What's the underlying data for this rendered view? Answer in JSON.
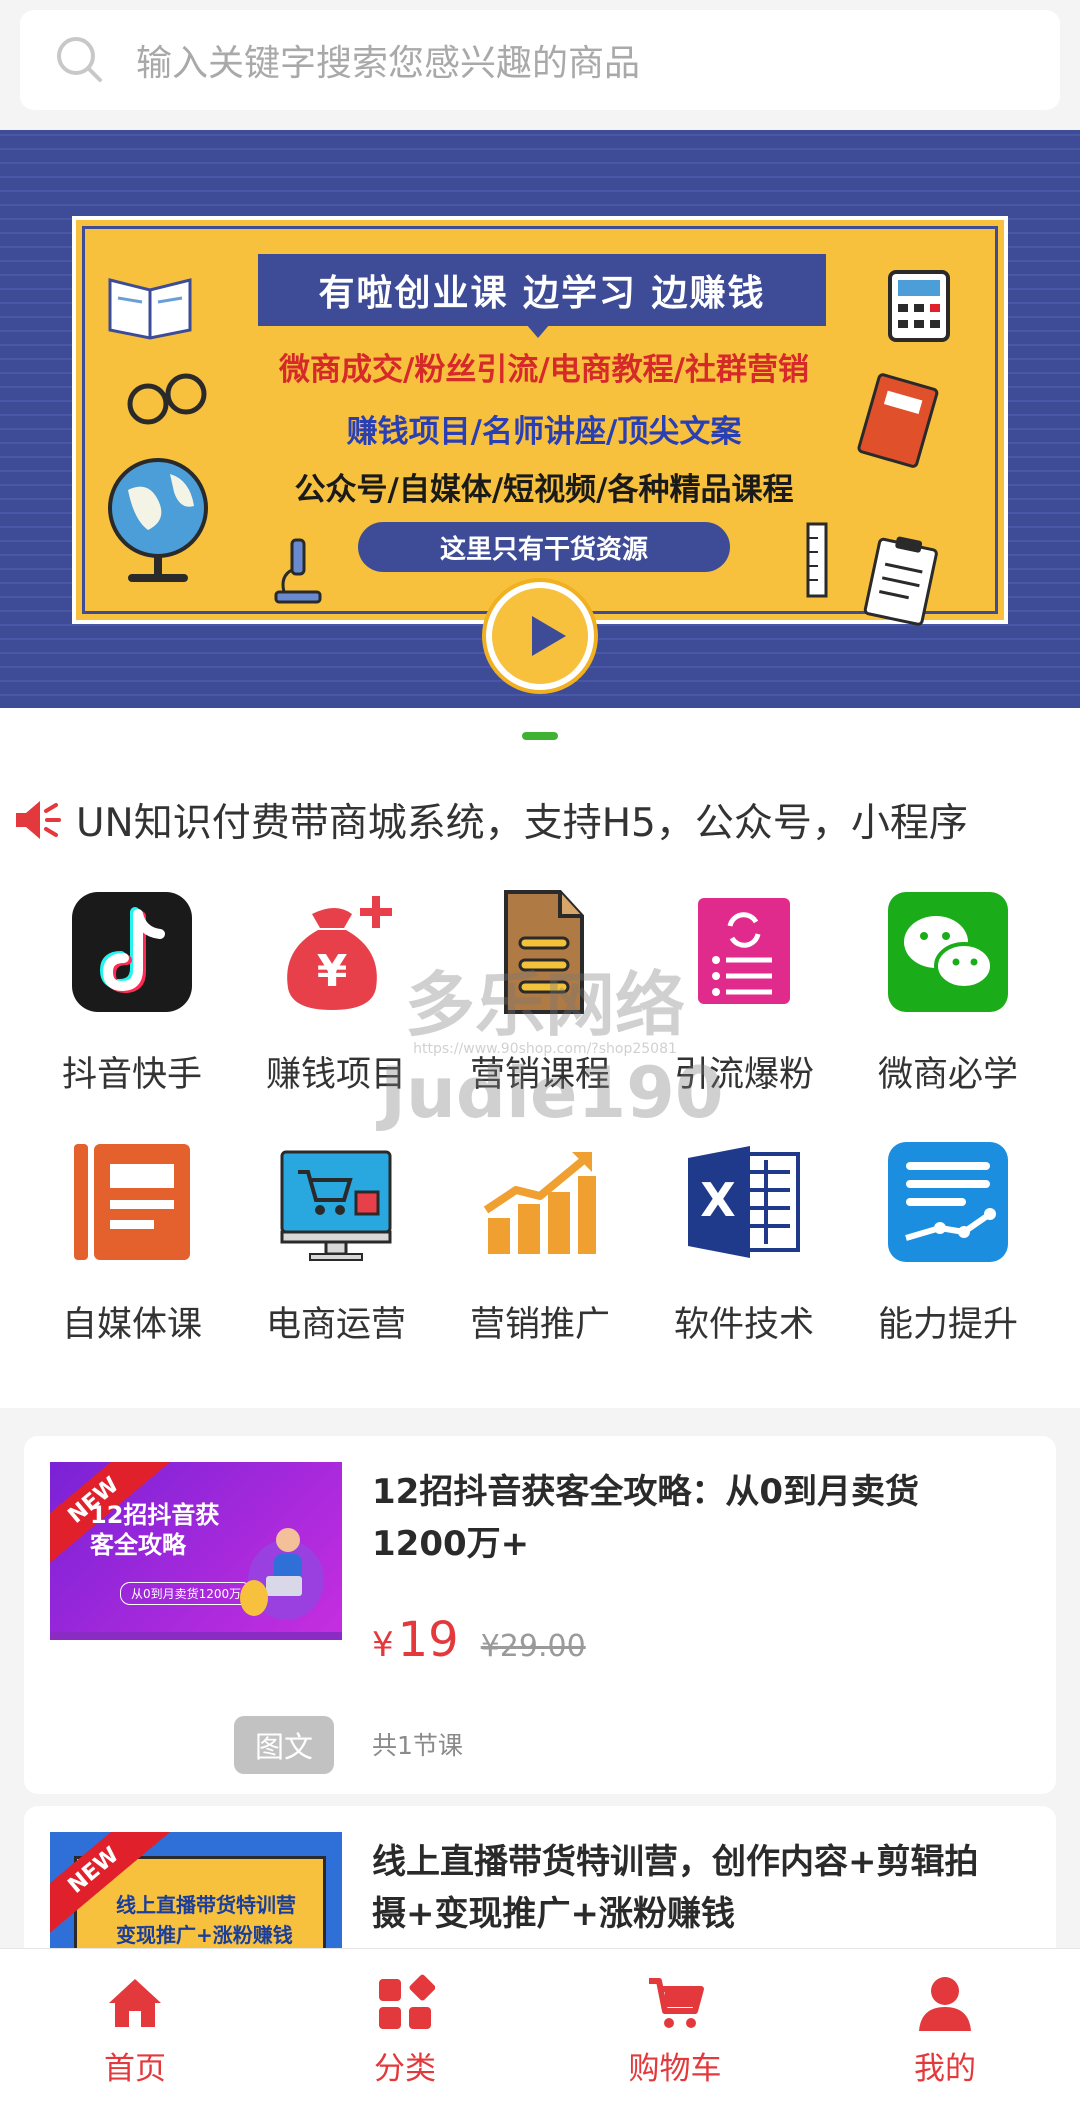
{
  "search": {
    "placeholder": "输入关键字搜索您感兴趣的商品"
  },
  "banner": {
    "title": "有啦创业课  边学习  边赚钱",
    "line1": "微商成交/粉丝引流/电商教程/社群营销",
    "line2": "赚钱项目/名师讲座/顶尖文案",
    "line3": "公众号/自媒体/短视频/各种精品课程",
    "pill": "这里只有干货资源"
  },
  "notice": {
    "text": "UN知识付费带商城系统，支持H5，公众号，小程序"
  },
  "categories": [
    {
      "label": "抖音快手",
      "icon": "tiktok-icon"
    },
    {
      "label": "赚钱项目",
      "icon": "money-bag-icon"
    },
    {
      "label": "营销课程",
      "icon": "document-icon"
    },
    {
      "label": "引流爆粉",
      "icon": "refresh-list-icon"
    },
    {
      "label": "微商必学",
      "icon": "wechat-icon"
    },
    {
      "label": "自媒体课",
      "icon": "notebook-icon"
    },
    {
      "label": "电商运营",
      "icon": "shopping-monitor-icon"
    },
    {
      "label": "营销推广",
      "icon": "growth-chart-icon"
    },
    {
      "label": "软件技术",
      "icon": "excel-icon"
    },
    {
      "label": "能力提升",
      "icon": "trend-line-icon"
    }
  ],
  "watermark": {
    "main": "多乐网络",
    "sub": "https://www.90shop.com/?shop25081",
    "code": "Judie190"
  },
  "products": [
    {
      "ribbon": "NEW",
      "thumb_title": "12招抖音获\n客全攻略",
      "thumb_sub": "从0到月卖货1200万",
      "title": "12招抖音获客全攻略：从0到月卖货1200万+",
      "price_symbol": "¥",
      "price": "19",
      "price_old": "¥29.00",
      "type": "图文",
      "lessons": "共1节课"
    },
    {
      "ribbon": "NEW",
      "thumb_title": "线上直播带货特训营\n变现推广+涨粉赚钱",
      "title": "线上直播带货特训营，创作内容+剪辑拍摄+变现推广+涨粉赚钱"
    }
  ],
  "tabbar": [
    {
      "label": "首页",
      "icon": "home-icon"
    },
    {
      "label": "分类",
      "icon": "category-icon"
    },
    {
      "label": "购物车",
      "icon": "cart-icon"
    },
    {
      "label": "我的",
      "icon": "user-icon"
    }
  ],
  "colors": {
    "accent": "#e4393c",
    "indicator": "#3fb233",
    "banner_blue": "#3e4c98",
    "banner_yellow": "#f7c13e"
  }
}
